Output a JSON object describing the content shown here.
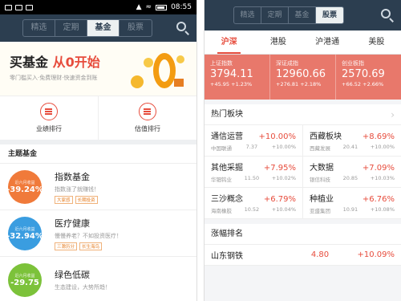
{
  "left": {
    "status": {
      "time": "08:55"
    },
    "nav_tabs": [
      "精选",
      "定期",
      "基金",
      "股票"
    ],
    "active_tab": "基金",
    "banner": {
      "title_plain": "买基金 ",
      "title_highlight": "从0开始",
      "subtitle": "零门槛买入·免费理财·快速资金到账"
    },
    "quick_links": [
      {
        "label": "业绩排行",
        "icon": "list-icon"
      },
      {
        "label": "估值排行",
        "icon": "chart-icon"
      }
    ],
    "section_title": "主题基金",
    "funds": [
      {
        "period": "近六月收益",
        "return": "-39.24%",
        "name": "指数基金",
        "desc": "指数涨了就赚钱！",
        "tags": [
          "大家感",
          "长期投资"
        ],
        "color": "#f07a3a"
      },
      {
        "period": "近六月收益",
        "return": "-32.94%",
        "name": "医疗健康",
        "desc": "慢慢养老？不如投资医疗！",
        "tags": [
          "三滁历分",
          "长生海鸟"
        ],
        "color": "#3a9de0"
      },
      {
        "period": "近六月收益",
        "return": "-29.75",
        "name": "绿色低碳",
        "desc": "生态建设，大势所趋！",
        "tags": [],
        "color": "#7cc23a"
      }
    ]
  },
  "right": {
    "nav_tabs": [
      "精选",
      "定期",
      "基金",
      "股票"
    ],
    "active_tab": "股票",
    "market_tabs": [
      "沪深",
      "港股",
      "沪港通",
      "美股"
    ],
    "active_market": "沪深",
    "indices": [
      {
        "name": "上证指数",
        "value": "3794.11",
        "change": "+45.95 +1.23%"
      },
      {
        "name": "深证成指",
        "value": "12960.66",
        "change": "+276.81 +2.18%"
      },
      {
        "name": "创业板指",
        "value": "2570.69",
        "change": "+66.52 +2.66%"
      }
    ],
    "hot_title": "热门板块",
    "hot_blocks": [
      [
        {
          "name": "通信运营",
          "pct": "+10.00%",
          "lead": "中国联通",
          "price": "7.37",
          "lead_pct": "+10.00%"
        },
        {
          "name": "西藏板块",
          "pct": "+8.69%",
          "lead": "西藏发展",
          "price": "20.41",
          "lead_pct": "+10.00%"
        }
      ],
      [
        {
          "name": "其他采掘",
          "pct": "+7.95%",
          "lead": "华钿钨业",
          "price": "11.50",
          "lead_pct": "+10.02%"
        },
        {
          "name": "大数据",
          "pct": "+7.09%",
          "lead": "银信科技",
          "price": "20.85",
          "lead_pct": "+10.03%"
        }
      ],
      [
        {
          "name": "三沙概念",
          "pct": "+6.79%",
          "lead": "海南橡胶",
          "price": "10.52",
          "lead_pct": "+10.04%"
        },
        {
          "name": "种植业",
          "pct": "+6.76%",
          "lead": "亚盛集团",
          "price": "10.91",
          "lead_pct": "+10.08%"
        }
      ]
    ],
    "rank_title": "涨幅排名",
    "rank_rows": [
      {
        "name": "山东钢铁",
        "price": "4.80",
        "pct": "+10.09%"
      }
    ]
  }
}
